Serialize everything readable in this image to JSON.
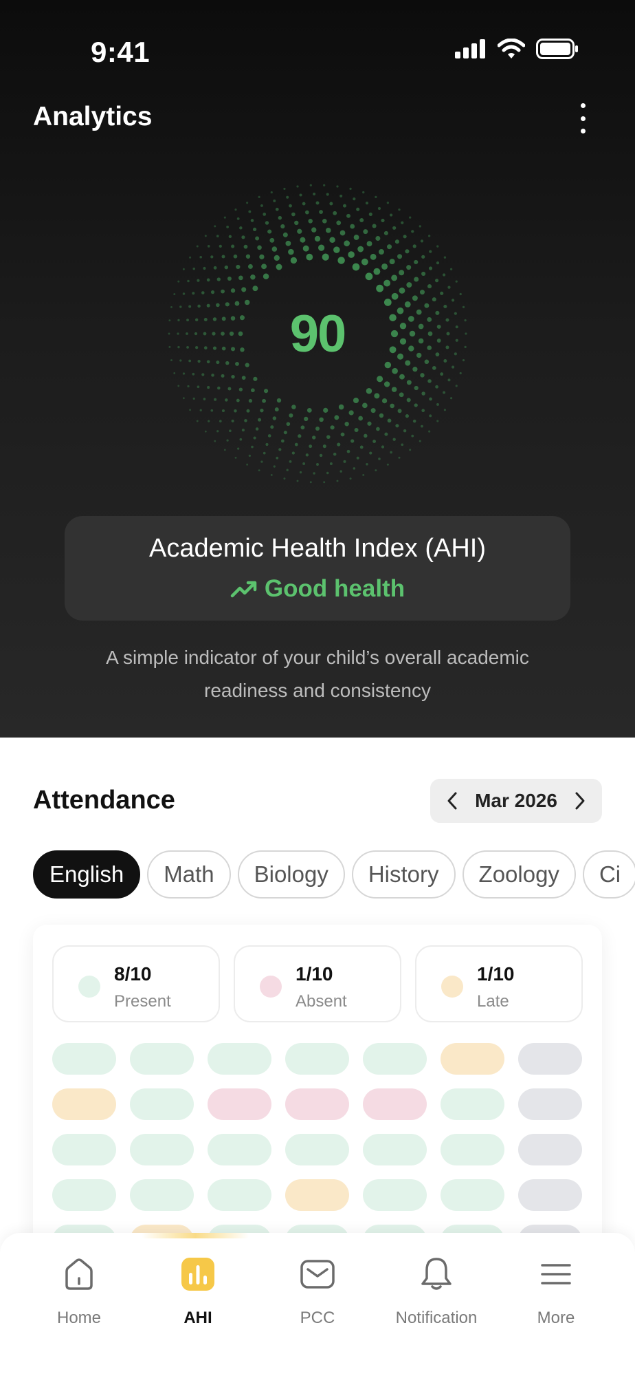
{
  "status_bar": {
    "time": "9:41"
  },
  "header": {
    "title": "Analytics"
  },
  "ahi": {
    "score": "90",
    "title": "Academic Health Index (AHI)",
    "status": "Good health",
    "description": "A simple indicator of your child’s overall academic readiness and consistency",
    "accent_color": "#5cc26e"
  },
  "attendance": {
    "title": "Attendance",
    "month": "Mar 2026",
    "subjects": [
      {
        "label": "English",
        "active": true
      },
      {
        "label": "Math",
        "active": false
      },
      {
        "label": "Biology",
        "active": false
      },
      {
        "label": "History",
        "active": false
      },
      {
        "label": "Zoology",
        "active": false
      },
      {
        "label": "Ci",
        "active": false
      }
    ],
    "stats": [
      {
        "value": "8/10",
        "label": "Present",
        "color": "#e2f3ea"
      },
      {
        "value": "1/10",
        "label": "Absent",
        "color": "#f5dbe3"
      },
      {
        "value": "1/10",
        "label": "Late",
        "color": "#fae8c8"
      }
    ],
    "calendar": [
      [
        "present",
        "present",
        "present",
        "present",
        "present",
        "late",
        "off"
      ],
      [
        "late",
        "present",
        "absent",
        "absent",
        "absent",
        "present",
        "off"
      ],
      [
        "present",
        "present",
        "present",
        "present",
        "present",
        "present",
        "off"
      ],
      [
        "present",
        "present",
        "present",
        "late",
        "present",
        "present",
        "off"
      ],
      [
        "present",
        "late",
        "present",
        "present",
        "present",
        "present",
        "off"
      ]
    ]
  },
  "tab_bar": {
    "items": [
      {
        "label": "Home",
        "icon": "home-icon",
        "active": false
      },
      {
        "label": "AHI",
        "icon": "chart-icon",
        "active": true
      },
      {
        "label": "PCC",
        "icon": "mail-icon",
        "active": false
      },
      {
        "label": "Notification",
        "icon": "bell-icon",
        "active": false
      },
      {
        "label": "More",
        "icon": "menu-icon",
        "active": false
      }
    ],
    "active_color": "#f6c848"
  }
}
